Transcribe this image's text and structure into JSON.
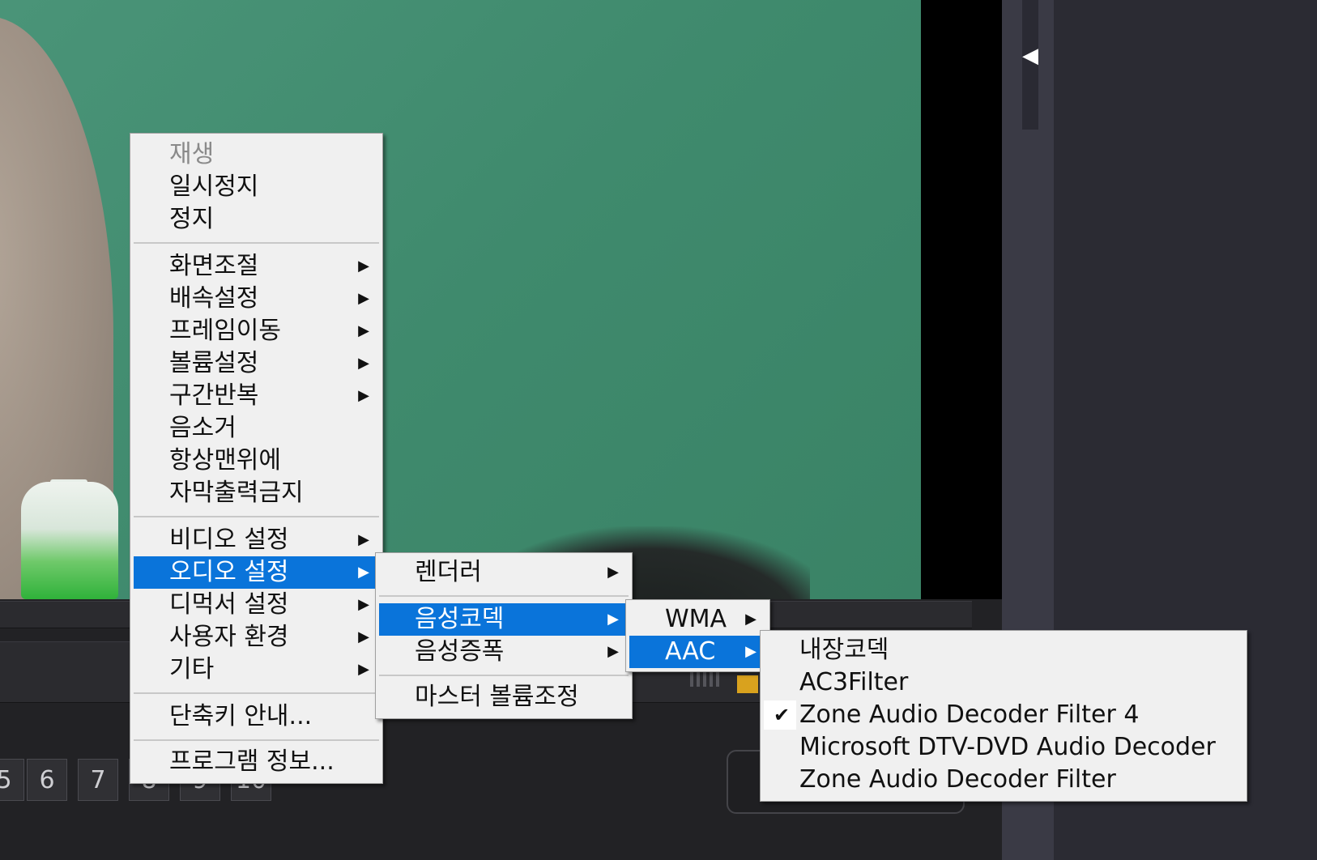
{
  "player": {
    "number_buttons": [
      "5",
      "6",
      "7",
      "8",
      "9",
      "10"
    ]
  },
  "main_menu": {
    "items": [
      {
        "label": "재생",
        "disabled": true
      },
      {
        "label": "일시정지"
      },
      {
        "label": "정지"
      },
      {
        "label": "화면조절",
        "submenu": true
      },
      {
        "label": "배속설정",
        "submenu": true
      },
      {
        "label": "프레임이동",
        "submenu": true
      },
      {
        "label": "볼륨설정",
        "submenu": true
      },
      {
        "label": "구간반복",
        "submenu": true
      },
      {
        "label": "음소거"
      },
      {
        "label": "항상맨위에"
      },
      {
        "label": "자막출력금지"
      },
      {
        "label": "비디오 설정",
        "submenu": true
      },
      {
        "label": "오디오 설정",
        "submenu": true,
        "highlighted": true
      },
      {
        "label": "디먹서 설정",
        "submenu": true
      },
      {
        "label": "사용자 환경",
        "submenu": true
      },
      {
        "label": "기타",
        "submenu": true
      },
      {
        "label": "단축키 안내..."
      },
      {
        "label": "프로그램 정보..."
      }
    ]
  },
  "audio_menu": {
    "items": [
      {
        "label": "렌더러",
        "submenu": true
      },
      {
        "label": "음성코덱",
        "submenu": true,
        "highlighted": true
      },
      {
        "label": "음성증폭",
        "submenu": true
      },
      {
        "label": "마스터 볼륨조정"
      }
    ]
  },
  "codec_menu": {
    "items": [
      {
        "label": "WMA",
        "submenu": true
      },
      {
        "label": "AAC",
        "submenu": true,
        "highlighted": true
      }
    ]
  },
  "aac_menu": {
    "items": [
      {
        "label": "내장코덱"
      },
      {
        "label": "AC3Filter"
      },
      {
        "label": "Zone Audio Decoder Filter 4",
        "checked": true
      },
      {
        "label": "Microsoft DTV-DVD Audio Decoder"
      },
      {
        "label": "Zone Audio Decoder Filter"
      }
    ]
  },
  "glyphs": {
    "submenu_arrow": "▶",
    "check": "✔",
    "collapse": "◀"
  },
  "colors": {
    "highlight": "#0a74da",
    "menu_bg": "#f0f0f0",
    "video_bg": "#3f8a6d"
  }
}
